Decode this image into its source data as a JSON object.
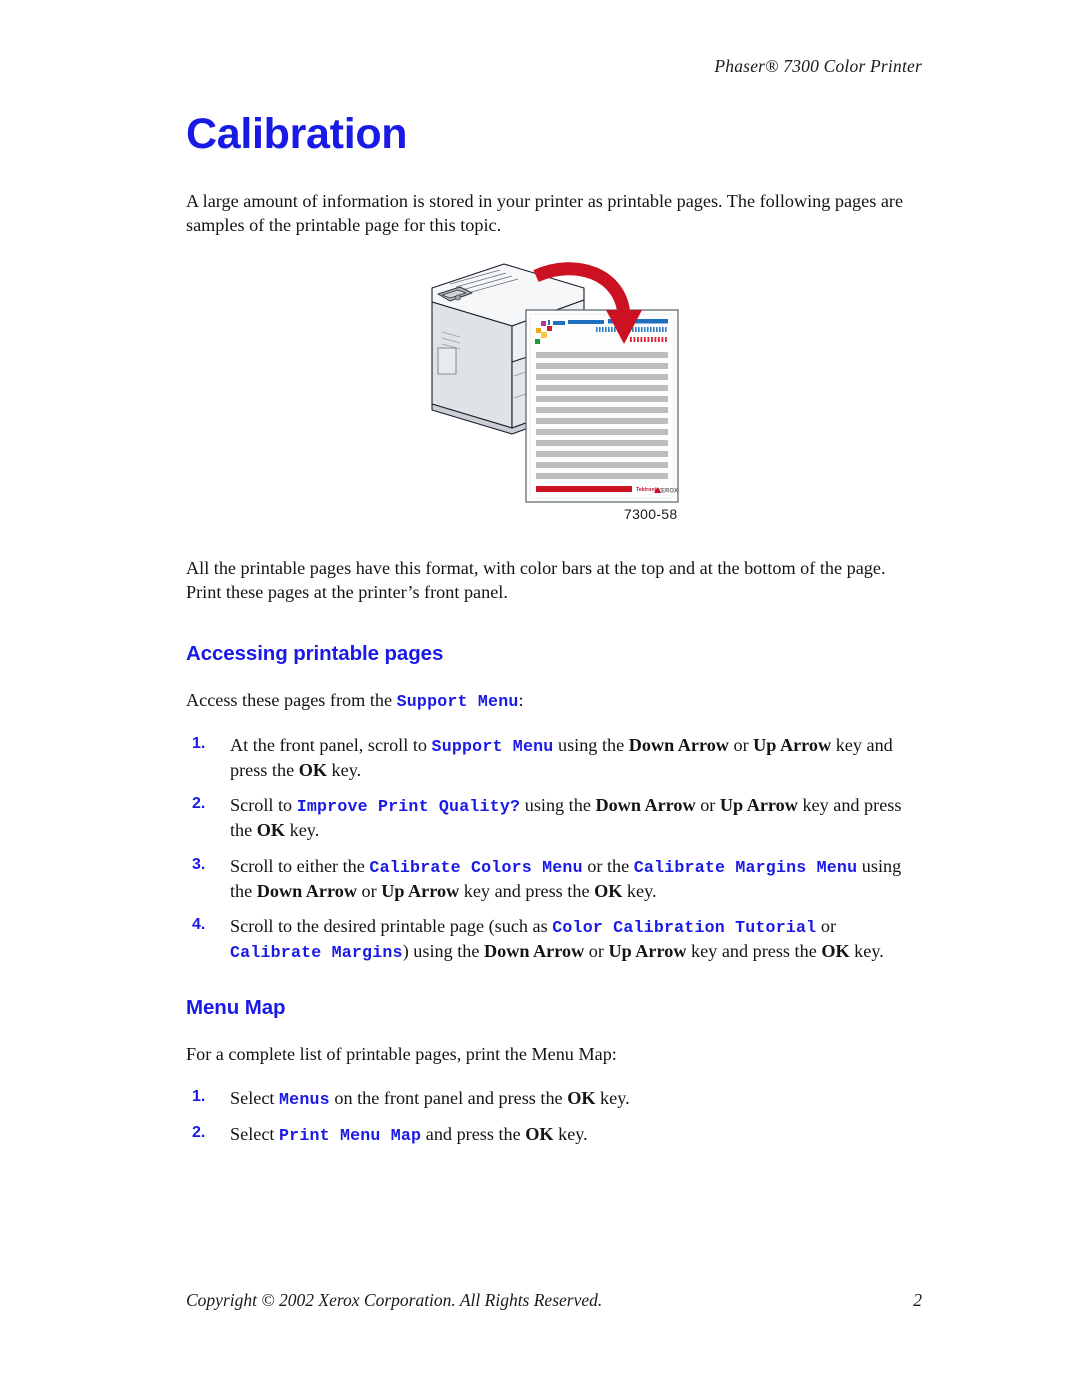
{
  "header": {
    "running_head": "Phaser® 7300 Color Printer"
  },
  "title": "Calibration",
  "intro_paragraph": "A large amount of information is stored in your printer as printable pages. The following pages are samples of the printable page for this topic.",
  "figure": {
    "caption": "7300-58",
    "logo_tektronix": "Tektronix",
    "logo_xerox": "XEROX",
    "alt": "Printer with red arrow pointing to a printed calibration page with color bars at top and bottom"
  },
  "format_paragraph": "All the printable pages have this format, with color bars at the top and at the bottom of the page. Print these pages at the printer’s front panel.",
  "sections": [
    {
      "heading": "Accessing printable pages",
      "lead_in": {
        "before": "Access these pages from the ",
        "mono": "Support Menu",
        "after": ":"
      },
      "steps": [
        {
          "num": "1.",
          "parts": [
            {
              "t": "text",
              "v": "At the front panel, scroll to "
            },
            {
              "t": "mono",
              "v": "Support Menu"
            },
            {
              "t": "text",
              "v": " using the "
            },
            {
              "t": "key",
              "v": "Down Arrow"
            },
            {
              "t": "text",
              "v": " or "
            },
            {
              "t": "key",
              "v": "Up  Arrow"
            },
            {
              "t": "text",
              "v": " key and press the "
            },
            {
              "t": "key",
              "v": "OK"
            },
            {
              "t": "text",
              "v": " key."
            }
          ]
        },
        {
          "num": "2.",
          "parts": [
            {
              "t": "text",
              "v": "Scroll to "
            },
            {
              "t": "mono",
              "v": "Improve Print Quality?"
            },
            {
              "t": "text",
              "v": " using the "
            },
            {
              "t": "key",
              "v": "Down Arrow"
            },
            {
              "t": "text",
              "v": " or "
            },
            {
              "t": "key",
              "v": "Up  Arrow"
            },
            {
              "t": "text",
              "v": " key and press the "
            },
            {
              "t": "key",
              "v": "OK"
            },
            {
              "t": "text",
              "v": " key."
            }
          ]
        },
        {
          "num": "3.",
          "parts": [
            {
              "t": "text",
              "v": "Scroll to either the "
            },
            {
              "t": "mono",
              "v": "Calibrate Colors Menu"
            },
            {
              "t": "text",
              "v": " or the "
            },
            {
              "t": "mono",
              "v": "Calibrate Margins Menu"
            },
            {
              "t": "text",
              "v": " using the "
            },
            {
              "t": "key",
              "v": "Down Arrow"
            },
            {
              "t": "text",
              "v": " or "
            },
            {
              "t": "key",
              "v": "Up  Arrow"
            },
            {
              "t": "text",
              "v": " key and press the "
            },
            {
              "t": "key",
              "v": "OK"
            },
            {
              "t": "text",
              "v": " key."
            }
          ]
        },
        {
          "num": "4.",
          "parts": [
            {
              "t": "text",
              "v": "Scroll to the desired printable page (such as "
            },
            {
              "t": "mono",
              "v": "Color Calibration Tutorial"
            },
            {
              "t": "text",
              "v": " or "
            },
            {
              "t": "mono",
              "v": "Calibrate Margins"
            },
            {
              "t": "text",
              "v": ") using the "
            },
            {
              "t": "key",
              "v": "Down  Arrow"
            },
            {
              "t": "text",
              "v": " or "
            },
            {
              "t": "key",
              "v": "Up  Arrow"
            },
            {
              "t": "text",
              "v": " key and press the "
            },
            {
              "t": "key",
              "v": "OK"
            },
            {
              "t": "text",
              "v": " key."
            }
          ]
        }
      ]
    },
    {
      "heading": "Menu Map",
      "lead_in_plain": "For a complete list of printable pages, print the Menu Map:",
      "steps": [
        {
          "num": "1.",
          "parts": [
            {
              "t": "text",
              "v": "Select "
            },
            {
              "t": "mono",
              "v": "Menus"
            },
            {
              "t": "text",
              "v": " on the front panel and press the "
            },
            {
              "t": "key",
              "v": "OK"
            },
            {
              "t": "text",
              "v": " key."
            }
          ]
        },
        {
          "num": "2.",
          "parts": [
            {
              "t": "text",
              "v": "Select "
            },
            {
              "t": "mono",
              "v": "Print Menu Map"
            },
            {
              "t": "text",
              "v": " and press the "
            },
            {
              "t": "key",
              "v": "OK"
            },
            {
              "t": "text",
              "v": " key."
            }
          ]
        }
      ]
    }
  ],
  "footer": {
    "copyright": "Copyright © 2002 Xerox Corporation. All Rights Reserved.",
    "page_number": "2"
  },
  "colors": {
    "heading_blue": "#1a1ae6",
    "mono_blue": "#1a1ae6",
    "arrow_red": "#cc1122",
    "bar_red": "#d11a2a",
    "bar_blue": "#1f6fc0",
    "gray_line": "#bdbdbd",
    "printer_body": "#e8eaec",
    "text_black": "#141414"
  }
}
